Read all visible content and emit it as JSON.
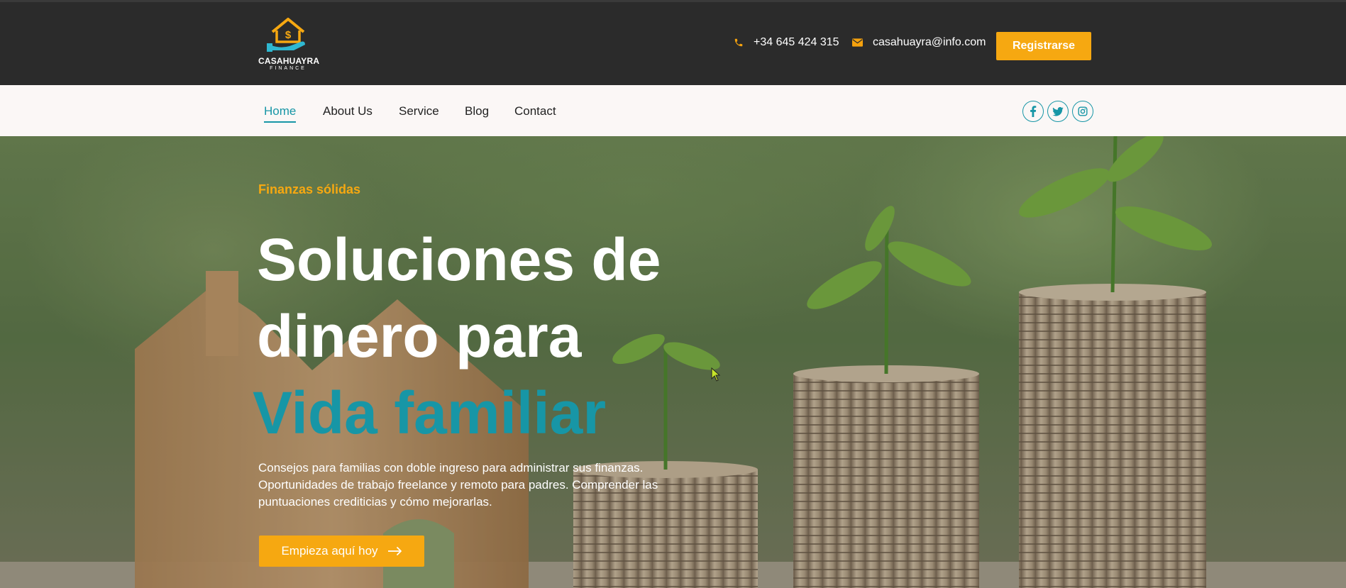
{
  "brand": {
    "name": "CASAHUAYRA",
    "sub": "FINANCE",
    "logo_icon": "house-dollar-hand-icon",
    "colors": {
      "accent": "#f6a811",
      "teal": "#1796a6",
      "dark": "#2b2b2b"
    }
  },
  "topbar": {
    "phone": "+34 645 424 315",
    "email": "casahuayra@info.com",
    "register_label": "Registrarse"
  },
  "nav": {
    "items": [
      {
        "label": "Home",
        "active": true
      },
      {
        "label": "About Us"
      },
      {
        "label": "Service"
      },
      {
        "label": "Blog"
      },
      {
        "label": "Contact"
      }
    ],
    "social": [
      "facebook-icon",
      "twitter-icon",
      "instagram-icon"
    ]
  },
  "hero": {
    "eyebrow": "Finanzas sólidas",
    "headline_line1": "Soluciones de",
    "headline_line2": "dinero para",
    "headline_accent": "Vida familiar",
    "description": "Consejos para familias con doble ingreso para administrar sus finanzas. Oportunidades de trabajo freelance y remoto para padres. Comprender las puntuaciones crediticias y cómo mejorarlas.",
    "cta_label": "Empieza aquí hoy"
  }
}
